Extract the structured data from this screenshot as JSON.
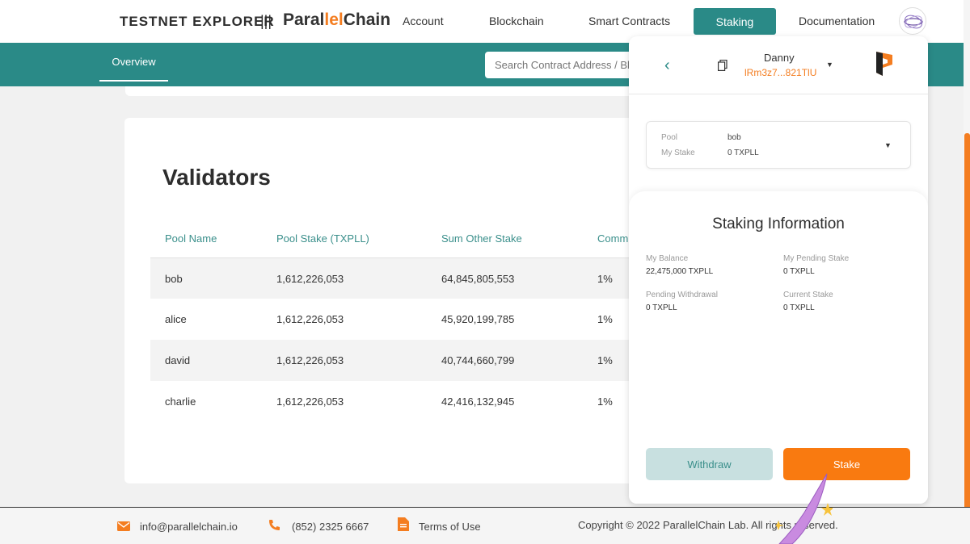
{
  "header": {
    "brand": "TESTNET EXPLORER",
    "separator": "|||",
    "logo_part1": "Paral",
    "logo_accent": "lel",
    "logo_part2": "Chain",
    "nav": [
      "Account",
      "Blockchain",
      "Smart Contracts",
      "Staking",
      "Documentation"
    ],
    "active_nav": "Staking"
  },
  "subbar": {
    "tab": "Overview",
    "search_placeholder": "Search Contract Address / Block"
  },
  "validators": {
    "title": "Validators",
    "columns": [
      "Pool Name",
      "Pool Stake (TXPLL)",
      "Sum Other Stake",
      "Comm"
    ],
    "rows": [
      [
        "bob",
        "1,612,226,053",
        "64,845,805,553",
        "1%"
      ],
      [
        "alice",
        "1,612,226,053",
        "45,920,199,785",
        "1%"
      ],
      [
        "david",
        "1,612,226,053",
        "40,744,660,799",
        "1%"
      ],
      [
        "charlie",
        "1,612,226,053",
        "42,416,132,945",
        "1%"
      ]
    ]
  },
  "wallet": {
    "account_name": "Danny",
    "account_address": "lRm3z7...821TlU",
    "pool_label": "Pool",
    "pool_value": "bob",
    "my_stake_label": "My Stake",
    "my_stake_value": "0 TXPLL",
    "info_title": "Staking Information",
    "my_balance_label": "My Balance",
    "my_balance_value": "22,475,000 TXPLL",
    "pending_stake_label": "My Pending Stake",
    "pending_stake_value": "0 TXPLL",
    "pending_withdrawal_label": "Pending Withdrawal",
    "pending_withdrawal_value": "0 TXPLL",
    "current_stake_label": "Current Stake",
    "current_stake_value": "0 TXPLL",
    "withdraw_label": "Withdraw",
    "stake_label": "Stake"
  },
  "footer": {
    "email": "info@parallelchain.io",
    "phone": "(852) 2325 6667",
    "terms": "Terms of Use",
    "copyright": "Copyright © 2022 ParallelChain Lab. All rights reserved."
  },
  "colors": {
    "teal": "#2a8a87",
    "orange": "#f47d20"
  }
}
